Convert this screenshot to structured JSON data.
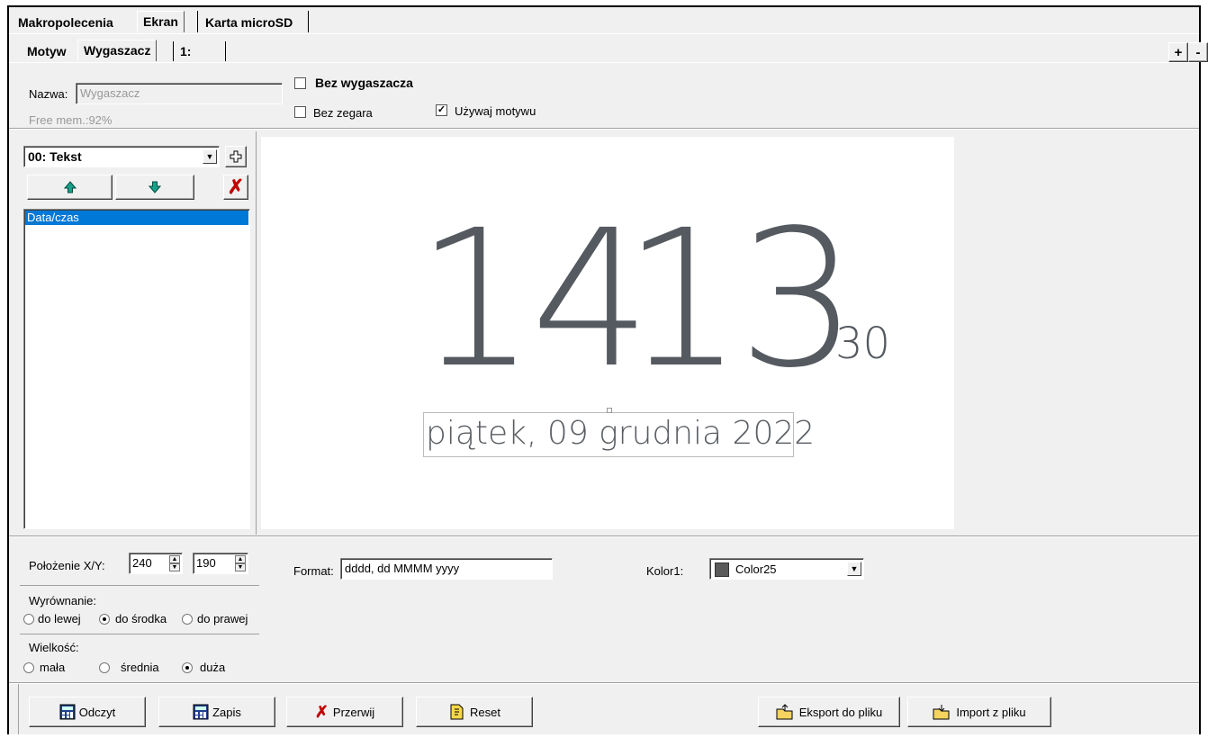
{
  "top_tabs": [
    "Makropolecenia",
    "Ekran",
    "Karta microSD"
  ],
  "sub_tabs": [
    "Motyw",
    "Wygaszacz",
    "1:"
  ],
  "pm_buttons": [
    "+",
    "-"
  ],
  "name_label": "Nazwa:",
  "name_value": "Wygaszacz",
  "free_mem": "Free mem.:92%",
  "checks": {
    "no_saver": {
      "label": "Bez wygaszacza",
      "checked": false
    },
    "no_clock": {
      "label": "Bez zegara",
      "checked": false
    },
    "use_theme": {
      "label": "Używaj motywu",
      "checked": true
    }
  },
  "element_select": "00: Tekst",
  "element_list": [
    "Data/czas"
  ],
  "preview": {
    "hour": "14",
    "colon": ":",
    "minute": "13",
    "seconds": "30",
    "date": "piątek, 09 grudnia 2022"
  },
  "position_label": "Położenie X/Y:",
  "pos_x": "240",
  "pos_y": "190",
  "format_label": "Format:",
  "format_value": "dddd, dd MMMM yyyy",
  "color_label": "Kolor1:",
  "color_value": "Color25",
  "color_swatch": "#5a5a5a",
  "align_label": "Wyrównanie:",
  "align_options": [
    "do lewej",
    "do środka",
    "do prawej"
  ],
  "align_selected": 1,
  "size_label": "Wielkość:",
  "size_options": [
    "mała",
    "średnia",
    "duża"
  ],
  "size_selected": 2,
  "bottom_buttons": {
    "read": "Odczyt",
    "write": "Zapis",
    "stop": "Przerwij",
    "reset": "Reset",
    "export": "Eksport do pliku",
    "import": "Import z pliku"
  }
}
